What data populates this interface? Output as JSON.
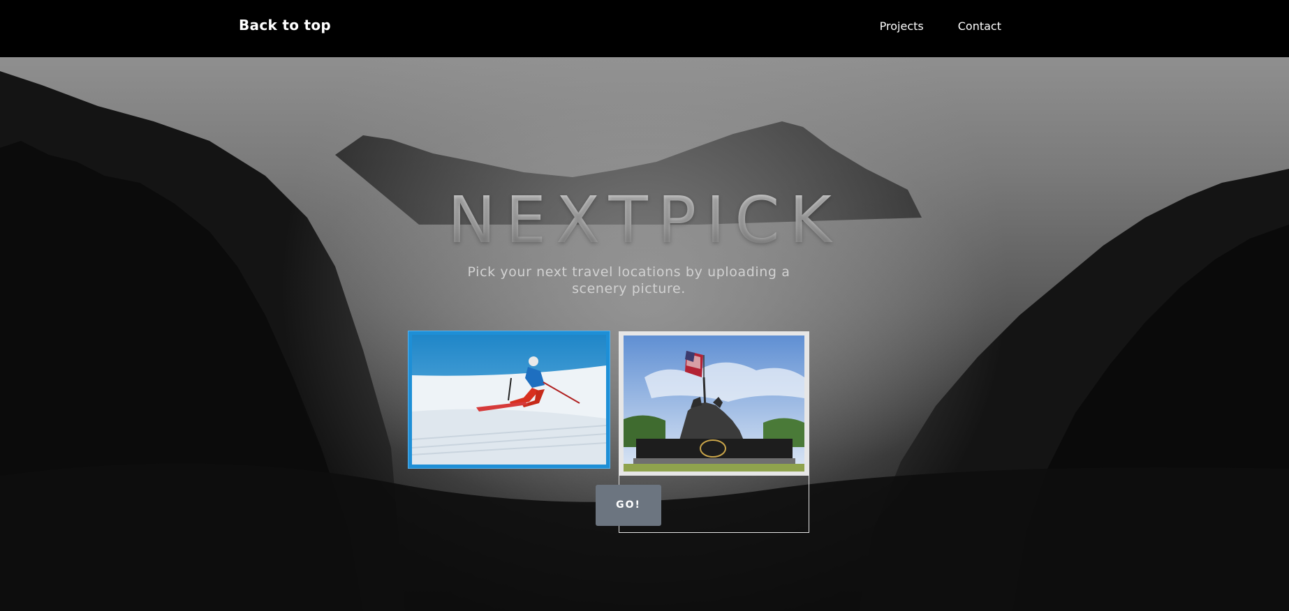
{
  "navbar": {
    "brand_label": "Back to top",
    "links": [
      {
        "label": "Projects"
      },
      {
        "label": "Contact"
      }
    ]
  },
  "hero": {
    "title": "NEXTPICK",
    "subtitle": "Pick your next travel locations by uploading a scenery picture.",
    "background_icon": "misty-mountain-forest",
    "choices": [
      {
        "icon": "skier-photo",
        "selected": true
      },
      {
        "icon": "flag-memorial-photo",
        "selected": false
      }
    ],
    "go_label": "GO!"
  },
  "colors": {
    "selected_border": "#1e8fd6",
    "button": "#6c7580",
    "navbar": "#000000"
  }
}
